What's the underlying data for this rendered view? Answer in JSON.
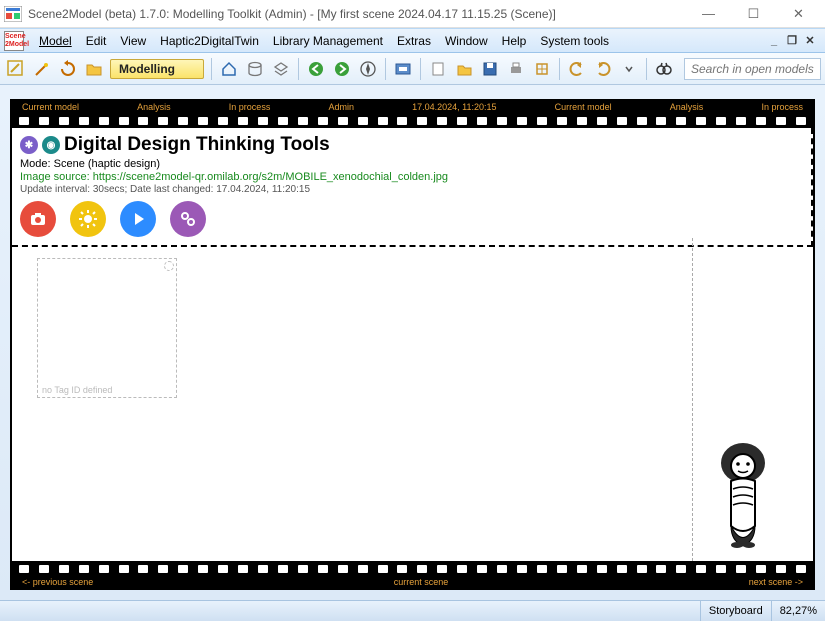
{
  "window": {
    "title": "Scene2Model (beta) 1.7.0: Modelling Toolkit (Admin) - [My first scene 2024.04.17 11.15.25 (Scene)]"
  },
  "menu": {
    "items": [
      "Model",
      "Edit",
      "View",
      "Haptic2DigitalTwin",
      "Library Management",
      "Extras",
      "Window",
      "Help",
      "System tools"
    ]
  },
  "toolbar": {
    "mode_label": "Modelling",
    "search_placeholder": "Search in open models"
  },
  "filmstrip": {
    "top_labels": [
      "Current model",
      "Analysis",
      "In process",
      "Admin",
      "17.04.2024, 11:20:15",
      "Current model",
      "Analysis",
      "In process"
    ],
    "bottom_left": "<- previous scene",
    "bottom_center": "current scene",
    "bottom_right": "next scene ->"
  },
  "scene": {
    "title": "Digital Design Thinking Tools",
    "mode_line": "Mode: Scene (haptic design)",
    "source_line": "Image source: https://scene2model-qr.omilab.org/s2m/MOBILE_xenodochial_colden.jpg",
    "update_line": "Update interval: 30secs; Date last changed: 17.04.2024, 11:20:15",
    "placeholder_tag": "no Tag ID defined"
  },
  "hot_buttons": {
    "camera_color": "#e74c3c",
    "sun_color": "#f1c40f",
    "play_color": "#2d8cff",
    "gear_color": "#9b59b6"
  },
  "status": {
    "view": "Storyboard",
    "zoom": "82,27%"
  }
}
